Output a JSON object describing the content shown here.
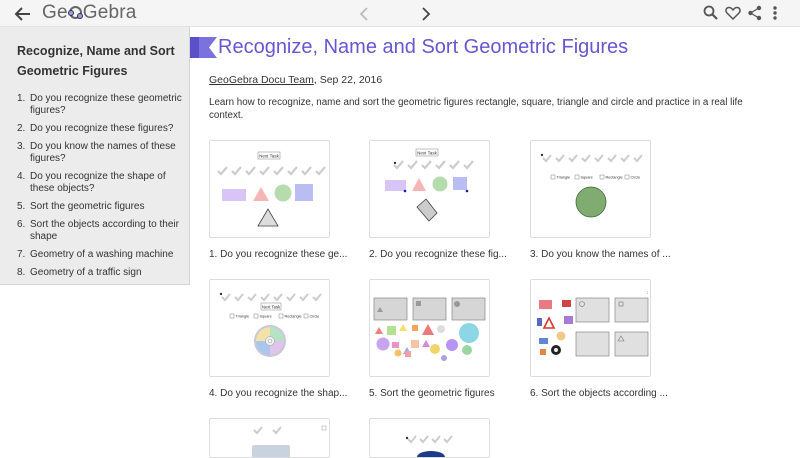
{
  "header": {
    "logo_text_left": "Ge",
    "logo_text_right": "Gebra"
  },
  "sidebar": {
    "title": "Recognize, Name and Sort Geometric Figures",
    "items": [
      {
        "num": "1.",
        "label": "Do you recognize these geometric figures?"
      },
      {
        "num": "2.",
        "label": "Do you recognize these figures?"
      },
      {
        "num": "3.",
        "label": "Do you know the names of these figures?"
      },
      {
        "num": "4.",
        "label": "Do you recognize the shape of these objects?"
      },
      {
        "num": "5.",
        "label": "Sort the geometric figures"
      },
      {
        "num": "6.",
        "label": "Sort the objects according to their shape"
      },
      {
        "num": "7.",
        "label": "Geometry of a washing machine"
      },
      {
        "num": "8.",
        "label": "Geometry of a traffic sign"
      }
    ]
  },
  "main": {
    "title": "Recognize, Name and Sort Geometric Figures",
    "author": "GeoGebra Docu Team",
    "date": ", Sep 22, 2016",
    "description": "Learn how to recognize, name and sort the geometric figures rectangle, square, triangle and circle and practice in a real life context.",
    "cards": [
      {
        "caption": "1. Do you recognize these ge...",
        "next_task": "Next Task"
      },
      {
        "caption": "2. Do you recognize these fig...",
        "next_task": "Next Task"
      },
      {
        "caption": "3. Do you know the names of ...",
        "options": [
          "Triangle",
          "Square",
          "Rectangle",
          "Circle"
        ]
      },
      {
        "caption": "4. Do you recognize the shap...",
        "next_task": "Next Task",
        "options": [
          "Triangle",
          "Square",
          "Rectangle",
          "Circle"
        ]
      },
      {
        "caption": "5. Sort the geometric figures"
      },
      {
        "caption": "6. Sort the objects according ..."
      },
      {
        "caption": ""
      },
      {
        "caption": ""
      }
    ]
  },
  "colors": {
    "accent": "#6557d2",
    "flag": "#7b72e0",
    "sidebar_bg": "#ececec",
    "topbar_bg": "#f5f5f5"
  },
  "icons": [
    "back-arrow-icon",
    "chevron-left-icon",
    "chevron-right-icon",
    "search-icon",
    "heart-icon",
    "share-icon",
    "more-vertical-icon"
  ]
}
